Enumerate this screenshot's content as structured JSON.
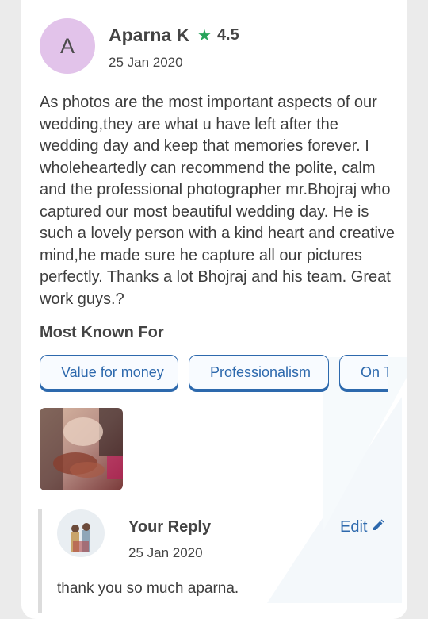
{
  "review": {
    "avatar_letter": "A",
    "name": "Aparna K",
    "rating": "4.5",
    "date": "25 Jan 2020",
    "text": "As photos are the most important aspects of our wedding,they are what u have left after the wedding day and keep that memories forever. I wholeheartedly can recommend the polite, calm and the professional photographer mr.Bhojraj who captured our most beautiful wedding day. He is such a lovely person with a kind heart and creative mind,he made sure he capture all our pictures perfectly. Thanks a lot Bhojraj and his team. Great work guys.?"
  },
  "known_for": {
    "title": "Most Known For",
    "chips": [
      "Value for money",
      "Professionalism",
      "On T"
    ]
  },
  "reply": {
    "title": "Your Reply",
    "date": "25 Jan 2020",
    "edit_label": "Edit",
    "text": "thank you so much aparna."
  },
  "icons": {
    "rating": "star-icon",
    "edit": "pencil-icon"
  },
  "colors": {
    "accent": "#2d69ad",
    "star": "#27a35a",
    "avatar_bg": "#e2c3ea"
  }
}
